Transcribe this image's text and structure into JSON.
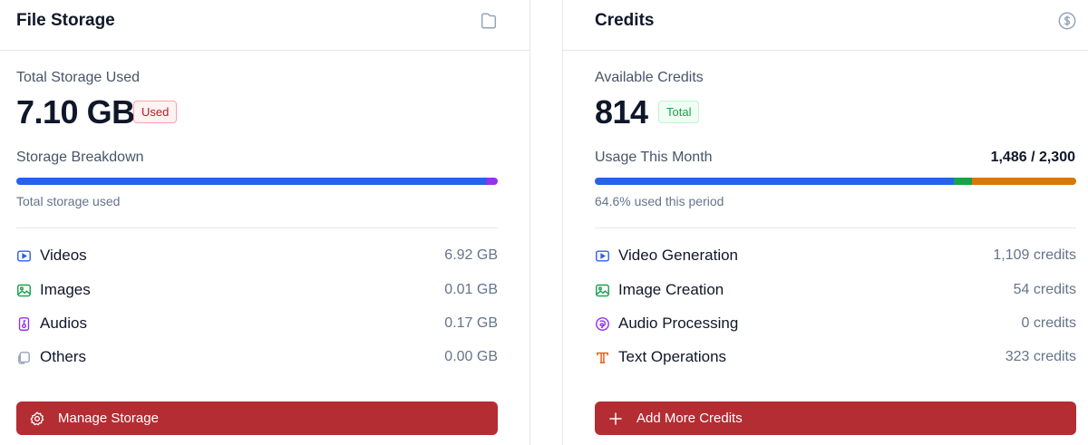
{
  "storage": {
    "title": "File Storage",
    "header_icon": "folder-icon",
    "total_label": "Total Storage Used",
    "total_value": "7.10 GB",
    "badge": "Used",
    "breakdown_label": "Storage Breakdown",
    "bar_segments": [
      {
        "name": "Videos",
        "fraction": 0.9746,
        "color": "#2563eb"
      },
      {
        "name": "Images",
        "fraction": 0.0014,
        "color": "#16a34a"
      },
      {
        "name": "Audios",
        "fraction": 0.024,
        "color": "#9333ea"
      }
    ],
    "bar_caption": "Total storage used",
    "items": [
      {
        "label": "Videos",
        "value": "6.92 GB",
        "icon": "video-icon",
        "color": "#2563eb"
      },
      {
        "label": "Images",
        "value": "0.01 GB",
        "icon": "image-icon",
        "color": "#16a34a"
      },
      {
        "label": "Audios",
        "value": "0.17 GB",
        "icon": "audio-file-icon",
        "color": "#9333ea"
      },
      {
        "label": "Others",
        "value": "0.00 GB",
        "icon": "files-icon",
        "color": "#94a3b8"
      }
    ],
    "button_label": "Manage Storage",
    "button_icon": "gear-icon"
  },
  "credits": {
    "title": "Credits",
    "header_icon": "dollar-circle-icon",
    "available_label": "Available Credits",
    "available_value": "814",
    "badge": "Total",
    "usage_label": "Usage This Month",
    "usage_count": "1,486 / 2,300",
    "bar_segments": [
      {
        "name": "Video Generation",
        "fraction": 0.7463,
        "color": "#2563eb"
      },
      {
        "name": "Image Creation",
        "fraction": 0.0363,
        "color": "#16a34a"
      },
      {
        "name": "Audio Processing",
        "fraction": 0.0,
        "color": "#9333ea"
      },
      {
        "name": "Text Operations",
        "fraction": 0.2174,
        "color": "#d97706"
      }
    ],
    "bar_caption": "64.6% used this period",
    "items": [
      {
        "label": "Video Generation",
        "value": "1,109 credits",
        "icon": "video-icon",
        "color": "#2563eb"
      },
      {
        "label": "Image Creation",
        "value": "54 credits",
        "icon": "image-icon",
        "color": "#16a34a"
      },
      {
        "label": "Audio Processing",
        "value": "0 credits",
        "icon": "audio-wave-icon",
        "color": "#9333ea"
      },
      {
        "label": "Text Operations",
        "value": "323 credits",
        "icon": "text-icon",
        "color": "#ea580c"
      }
    ],
    "button_label": "Add More Credits",
    "button_icon": "plus-icon"
  }
}
